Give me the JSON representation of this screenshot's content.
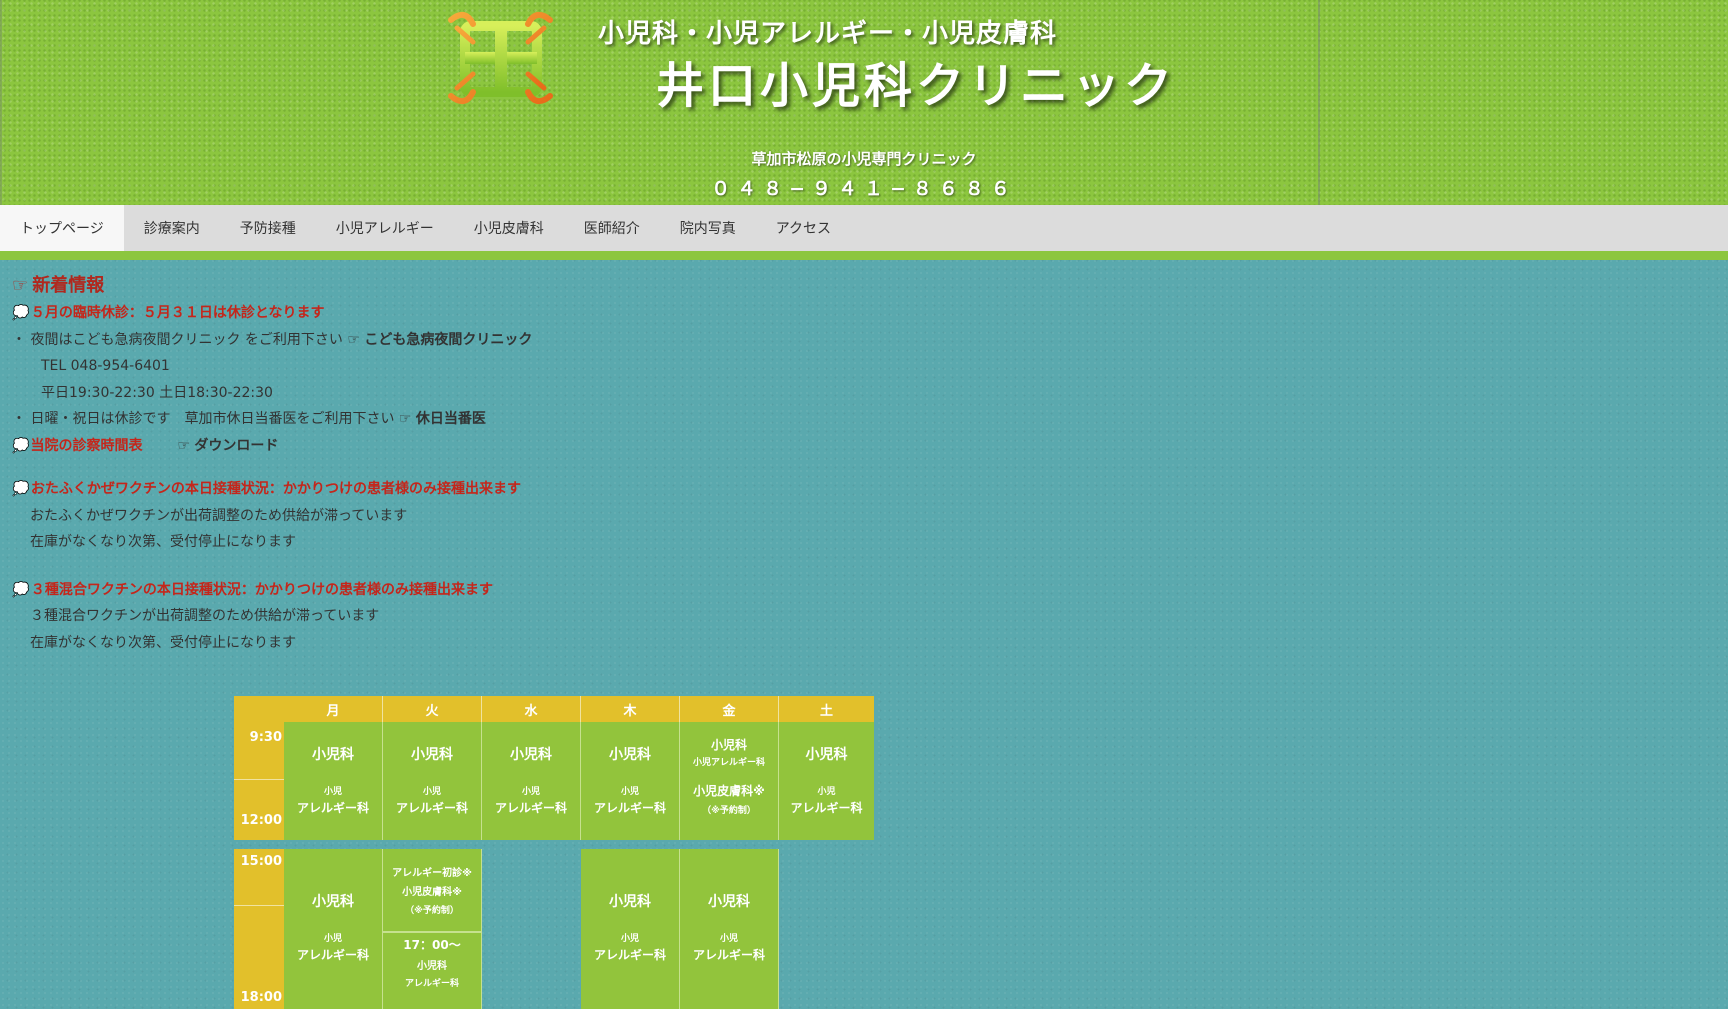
{
  "header": {
    "subtitle": "小児科・小児アレルギー・小児皮膚科",
    "clinic_name": "井口小児科クリニック",
    "tagline": "草加市松原の小児専門クリニック",
    "phone": "０４８−９４１−８６８６"
  },
  "nav": {
    "items": [
      "トップページ",
      "診療案内",
      "予防接種",
      "小児アレルギー",
      "小児皮膚科",
      "医師紹介",
      "院内写真",
      "アクセス"
    ],
    "active_index": 0
  },
  "news": {
    "heading": "新着情報",
    "hand_glyph": "☞",
    "bubble_glyph": "💭",
    "closure_notice": "５月の臨時休診：５月３１日は休診となります",
    "night": {
      "text": "夜間はこども急病夜間クリニック をご利用下さい",
      "link": "こども急病夜間クリニック",
      "tel": "TEL 048-954-6401",
      "hours": "平日19:30-22:30 土日18:30-22:30"
    },
    "holiday": {
      "text": "日曜・祝日は休診です　草加市休日当番医をご利用下さい",
      "link": "休日当番医"
    },
    "schedule_label": "当院の診察時間表",
    "download_link": "ダウンロード",
    "mumps": {
      "title": "おたふくかぜワクチンの本日接種状況：かかりつけの患者様のみ接種出来ます",
      "line1": "おたふくかぜワクチンが出荷調整のため供給が滞っています",
      "line2": "在庫がなくなり次第、受付停止になります"
    },
    "dpt": {
      "title": "３種混合ワクチンの本日接種状況：かかりつけの患者様のみ接種出来ます",
      "line1": "３種混合ワクチンが出荷調整のため供給が滞っています",
      "line2": "在庫がなくなり次第、受付停止になります"
    }
  },
  "schedule": {
    "days": [
      "月",
      "火",
      "水",
      "木",
      "金",
      "土"
    ],
    "morning_times": [
      "9:30",
      "12:00"
    ],
    "afternoon_times": [
      "15:00",
      "18:00"
    ],
    "pediatrics": "小児科",
    "allergy_small": "小児",
    "allergy_big": "アレルギー科",
    "fri_morning": {
      "line1": "小児科",
      "line2": "小児アレルギー科",
      "line3": "小児皮膚科※",
      "line4": "（※予約制）"
    },
    "tue_afternoon": {
      "line1": "アレルギー初診※",
      "line2": "小児皮膚科※",
      "line3": "（※予約制）",
      "line4": "17：00〜",
      "line5": "小児科",
      "line6": "アレルギー科"
    }
  },
  "colors": {
    "header_green": "#8cc63f",
    "body_teal": "#5aa9ae",
    "news_red": "#c4261b",
    "table_yellow": "#e2c02b",
    "table_green": "#92c43c"
  }
}
